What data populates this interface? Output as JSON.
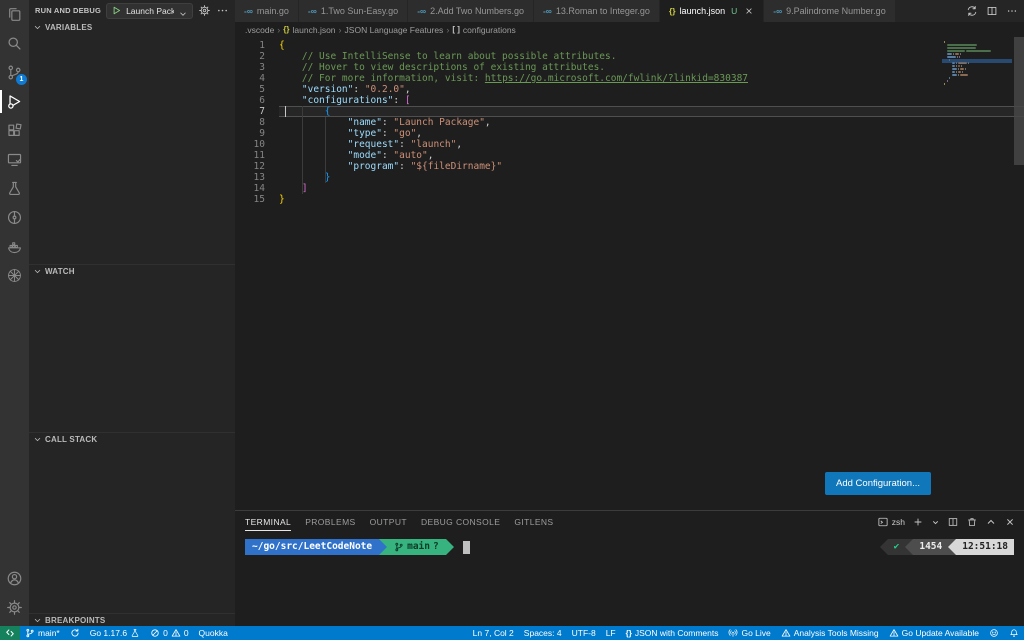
{
  "activity_bar": {
    "items": [
      {
        "name": "explorer",
        "icon": "files"
      },
      {
        "name": "search",
        "icon": "search"
      },
      {
        "name": "source-control",
        "icon": "source-control",
        "badge": "1"
      },
      {
        "name": "run-and-debug",
        "icon": "debug",
        "active": true
      },
      {
        "name": "extensions",
        "icon": "extensions"
      },
      {
        "name": "remote-explorer",
        "icon": "remote-explorer"
      },
      {
        "name": "testing",
        "icon": "beaker"
      },
      {
        "name": "git-graph",
        "icon": "circle-branch"
      },
      {
        "name": "docker",
        "icon": "docker"
      },
      {
        "name": "kubernetes",
        "icon": "kubernetes"
      }
    ],
    "bottom_items": [
      {
        "name": "accounts",
        "icon": "account"
      },
      {
        "name": "settings",
        "icon": "gear"
      }
    ]
  },
  "sidebar": {
    "title": "RUN AND DEBUG",
    "launch_dropdown": {
      "label": "Launch Package"
    },
    "sections": [
      {
        "label": "VARIABLES"
      },
      {
        "label": "WATCH"
      },
      {
        "label": "CALL STACK"
      },
      {
        "label": "BREAKPOINTS"
      }
    ]
  },
  "editor_tabs": [
    {
      "label": "main.go",
      "icon": "go"
    },
    {
      "label": "1.Two Sun-Easy.go",
      "icon": "go"
    },
    {
      "label": "2.Add Two Numbers.go",
      "icon": "go"
    },
    {
      "label": "13.Roman to Integer.go",
      "icon": "go"
    },
    {
      "label": "launch.json",
      "icon": "json",
      "modified": "U",
      "active": true
    },
    {
      "label": "9.Palindrome Number.go",
      "icon": "go"
    }
  ],
  "breadcrumb": [
    {
      "label": ".vscode"
    },
    {
      "label": "launch.json",
      "icon": "json"
    },
    {
      "label": "JSON Language Features"
    },
    {
      "label": "configurations",
      "icon": "brackets"
    }
  ],
  "editor": {
    "current_line": 7,
    "cursor": {
      "line": 7,
      "col": 2
    },
    "add_configuration_button": "Add Configuration...",
    "lines": [
      {
        "n": 1,
        "segs": [
          [
            "b1",
            "{"
          ]
        ]
      },
      {
        "n": 2,
        "segs": [
          [
            "c",
            "    // Use IntelliSense to learn about possible attributes."
          ]
        ]
      },
      {
        "n": 3,
        "segs": [
          [
            "c",
            "    // Hover to view descriptions of existing attributes."
          ]
        ]
      },
      {
        "n": 4,
        "segs": [
          [
            "c",
            "    // For more information, visit: "
          ],
          [
            "l",
            "https://go.microsoft.com/fwlink/?linkid=830387"
          ]
        ]
      },
      {
        "n": 5,
        "segs": [
          [
            "k",
            "    \"version\""
          ],
          [
            "p",
            ": "
          ],
          [
            "s",
            "\"0.2.0\""
          ],
          [
            "p",
            ","
          ]
        ]
      },
      {
        "n": 6,
        "segs": [
          [
            "k",
            "    \"configurations\""
          ],
          [
            "p",
            ": "
          ],
          [
            "b2",
            "["
          ]
        ]
      },
      {
        "n": 7,
        "segs": [
          [
            "b3",
            "        {"
          ]
        ]
      },
      {
        "n": 8,
        "segs": [
          [
            "k",
            "            \"name\""
          ],
          [
            "p",
            ": "
          ],
          [
            "s",
            "\"Launch Package\""
          ],
          [
            "p",
            ","
          ]
        ]
      },
      {
        "n": 9,
        "segs": [
          [
            "k",
            "            \"type\""
          ],
          [
            "p",
            ": "
          ],
          [
            "s",
            "\"go\""
          ],
          [
            "p",
            ","
          ]
        ]
      },
      {
        "n": 10,
        "segs": [
          [
            "k",
            "            \"request\""
          ],
          [
            "p",
            ": "
          ],
          [
            "s",
            "\"launch\""
          ],
          [
            "p",
            ","
          ]
        ]
      },
      {
        "n": 11,
        "segs": [
          [
            "k",
            "            \"mode\""
          ],
          [
            "p",
            ": "
          ],
          [
            "s",
            "\"auto\""
          ],
          [
            "p",
            ","
          ]
        ]
      },
      {
        "n": 12,
        "segs": [
          [
            "k",
            "            \"program\""
          ],
          [
            "p",
            ": "
          ],
          [
            "s",
            "\"${fileDirname}\""
          ]
        ]
      },
      {
        "n": 13,
        "segs": [
          [
            "b3",
            "        }"
          ]
        ]
      },
      {
        "n": 14,
        "segs": [
          [
            "b2",
            "    ]"
          ]
        ]
      },
      {
        "n": 15,
        "segs": [
          [
            "b1",
            "}"
          ]
        ]
      }
    ]
  },
  "panel": {
    "tabs": [
      {
        "label": "TERMINAL",
        "active": true
      },
      {
        "label": "PROBLEMS"
      },
      {
        "label": "OUTPUT"
      },
      {
        "label": "DEBUG CONSOLE"
      },
      {
        "label": "GITLENS"
      }
    ],
    "shell_label": "zsh",
    "terminal": {
      "path": "~/go/src/LeetCodeNote",
      "branch": "main",
      "branch_dirty": "?",
      "exit_ok": "✔",
      "history_number": "1454",
      "time": "12:51:18"
    }
  },
  "status_bar": {
    "left": [
      {
        "name": "remote-indicator",
        "bg": "#16825d",
        "parts": [
          {
            "icon": "remote"
          }
        ]
      },
      {
        "name": "git-branch",
        "parts": [
          {
            "icon": "branch"
          },
          {
            "text": "main*"
          }
        ]
      },
      {
        "name": "sync",
        "parts": [
          {
            "icon": "sync"
          }
        ]
      },
      {
        "name": "go-version",
        "parts": [
          {
            "text": "Go 1.17.6"
          },
          {
            "icon": "beaker"
          }
        ]
      },
      {
        "name": "problems",
        "parts": [
          {
            "icon": "error-circle"
          },
          {
            "text": "0"
          },
          {
            "icon": "warning"
          },
          {
            "text": "0"
          }
        ]
      },
      {
        "name": "quokka",
        "parts": [
          {
            "text": "Quokka"
          }
        ]
      }
    ],
    "right": [
      {
        "name": "cursor-position",
        "parts": [
          {
            "text": "Ln 7, Col 2"
          }
        ]
      },
      {
        "name": "indentation",
        "parts": [
          {
            "text": "Spaces: 4"
          }
        ]
      },
      {
        "name": "encoding",
        "parts": [
          {
            "text": "UTF-8"
          }
        ]
      },
      {
        "name": "eol",
        "parts": [
          {
            "text": "LF"
          }
        ]
      },
      {
        "name": "language-mode",
        "parts": [
          {
            "icon": "json-braces"
          },
          {
            "text": "JSON with Comments"
          }
        ]
      },
      {
        "name": "go-live",
        "parts": [
          {
            "icon": "broadcast"
          },
          {
            "text": "Go Live"
          }
        ]
      },
      {
        "name": "analysis-tools",
        "parts": [
          {
            "icon": "warning"
          },
          {
            "text": "Analysis Tools Missing"
          }
        ]
      },
      {
        "name": "go-update",
        "parts": [
          {
            "icon": "warning"
          },
          {
            "text": "Go Update Available"
          }
        ]
      },
      {
        "name": "feedback",
        "parts": [
          {
            "icon": "feedback"
          }
        ]
      },
      {
        "name": "notifications",
        "parts": [
          {
            "icon": "bell"
          }
        ]
      }
    ]
  },
  "colors": {
    "status_bar_bg": "#007acc",
    "remote_bg": "#16825d",
    "button_bg": "#1177bb",
    "json_key": "#9cdcfe",
    "json_string": "#ce9178",
    "comment": "#6a9955",
    "bracket1": "#ffd700",
    "bracket2": "#da70d6",
    "bracket3": "#179fff",
    "prompt_blue": "#3071c9",
    "prompt_green": "#36b37e",
    "tab_modified": "#73c991",
    "go_icon": "#519aba",
    "json_icon": "#cbcb41"
  }
}
